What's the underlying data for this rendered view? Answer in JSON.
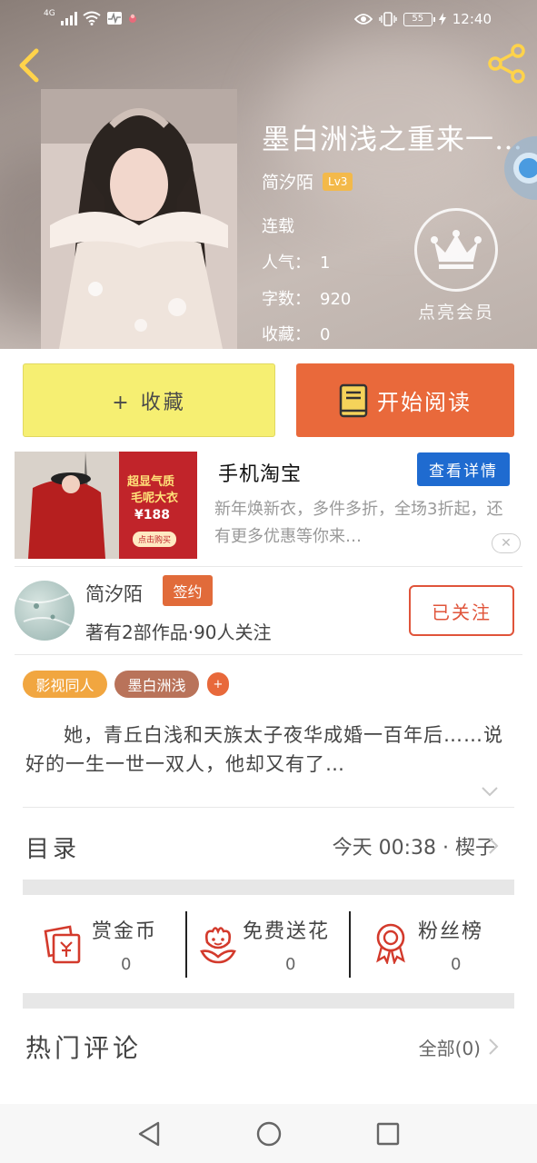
{
  "status_bar": {
    "network": "4G",
    "battery": "55",
    "time": "12:40"
  },
  "book": {
    "title": "墨白洲浅之重来一…",
    "author": "简汐陌",
    "level": "Lv3",
    "status": "连载",
    "popularity_label": "人气：",
    "popularity": "1",
    "words_label": "字数：",
    "words": "920",
    "favorites_label": "收藏：",
    "favorites": "0"
  },
  "vip": {
    "label": "点亮会员"
  },
  "actions": {
    "collect": "+ 收藏",
    "read": "开始阅读"
  },
  "ad": {
    "image_text_1": "超显气质",
    "image_text_2": "毛呢大衣",
    "image_price": "¥188",
    "image_cta": "点击购买",
    "title": "手机淘宝",
    "button": "查看详情",
    "description": "新年焕新衣，多件多折，全场3折起，还有更多优惠等你来…"
  },
  "author_card": {
    "name": "简汐陌",
    "badge": "签约",
    "stats": "著有2部作品·90人关注",
    "follow_button": "已关注"
  },
  "tags": [
    {
      "label": "影视同人",
      "color": "#f1a640"
    },
    {
      "label": "墨白洲浅",
      "color": "#b9735a"
    },
    {
      "label": "+",
      "color": "#e8693b"
    }
  ],
  "synopsis": "她，青丘白浅和天族太子夜华成婚一百年后……说好的一生一世一双人，他却又有了…",
  "toc": {
    "label": "目录",
    "update": "今天 00:38 · 楔子"
  },
  "stats": [
    {
      "label": "赏金币",
      "value": "0",
      "icon": "red-envelope-icon"
    },
    {
      "label": "免费送花",
      "value": "0",
      "icon": "flower-icon"
    },
    {
      "label": "粉丝榜",
      "value": "0",
      "icon": "medal-icon"
    }
  ],
  "comments": {
    "label": "热门评论",
    "all": "全部(0)"
  },
  "colors": {
    "accent_orange": "#e9693b",
    "collect_yellow": "#f6ef72",
    "ad_blue": "#1f6bd0",
    "follow_red": "#e0543a",
    "icon_red": "#d33a2c"
  }
}
